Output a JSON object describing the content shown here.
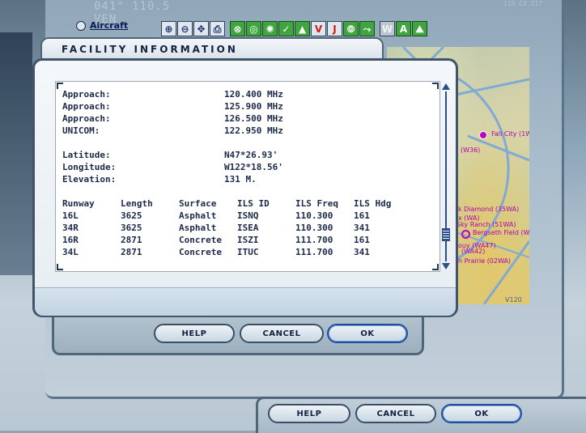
{
  "header": {
    "frequency_display": "041° 110.5 VEN",
    "right_display": "115 CX 117",
    "aircraft_label": "Aircraft"
  },
  "toolbar": {
    "buttons": [
      {
        "name": "zoom-in-icon",
        "glyph": "⊕",
        "style": "blue"
      },
      {
        "name": "zoom-out-icon",
        "glyph": "⊖",
        "style": "blue"
      },
      {
        "name": "center-icon",
        "glyph": "✥",
        "style": "blue"
      },
      {
        "name": "print-icon",
        "glyph": "⎙",
        "style": "blue"
      },
      {
        "name": "airport-icon",
        "glyph": "⊗",
        "style": "green"
      },
      {
        "name": "vor-icon",
        "glyph": "◎",
        "style": "green"
      },
      {
        "name": "ndb-icon",
        "glyph": "✺",
        "style": "green"
      },
      {
        "name": "ils-icon",
        "glyph": "✓",
        "style": "green"
      },
      {
        "name": "intersection-icon",
        "glyph": "▲",
        "style": "green"
      },
      {
        "name": "victor-airway-icon",
        "glyph": "V",
        "style": "red"
      },
      {
        "name": "jet-airway-icon",
        "glyph": "J",
        "style": "red"
      },
      {
        "name": "route-icon",
        "glyph": "⦾",
        "style": "green"
      },
      {
        "name": "flight-path-icon",
        "glyph": "⤳",
        "style": "green"
      },
      {
        "name": "wind-icon",
        "glyph": "W",
        "style": "grey"
      },
      {
        "name": "text-label-icon",
        "glyph": "A",
        "style": "green"
      },
      {
        "name": "terrain-icon",
        "glyph": "⛰",
        "style": "green"
      }
    ]
  },
  "map": {
    "labels": [
      "Fall City (1W",
      "ral (W36)",
      "k Diamond (35WA)",
      "x (WA)",
      "Sky Ranch (51WA)",
      "Bergseth Field (WA",
      "ouy (WA47)",
      "(WA42)",
      "h Prairie (02WA)",
      "V120"
    ]
  },
  "dialog": {
    "title": "FACILITY INFORMATION",
    "frequencies": [
      {
        "label": "Approach:",
        "value": "120.400 MHz"
      },
      {
        "label": "Approach:",
        "value": "125.900 MHz"
      },
      {
        "label": "Approach:",
        "value": "126.500 MHz"
      },
      {
        "label": "UNICOM:",
        "value": "122.950 MHz"
      }
    ],
    "location": [
      {
        "label": "Latitude:",
        "value": "N47*26.93'"
      },
      {
        "label": "Longitude:",
        "value": "W122*18.56'"
      },
      {
        "label": "Elevation:",
        "value": "131 M."
      }
    ],
    "runway_headers": [
      "Runway",
      "Length",
      "Surface",
      "ILS ID",
      "ILS Freq",
      "ILS Hdg"
    ],
    "runways": [
      [
        "16L",
        "3625",
        "Asphalt",
        "ISNQ",
        "110.300",
        "161"
      ],
      [
        "34R",
        "3625",
        "Asphalt",
        "ISEA",
        "110.300",
        "341"
      ],
      [
        "16R",
        "2871",
        "Concrete",
        "ISZI",
        "111.700",
        "161"
      ],
      [
        "34L",
        "2871",
        "Concrete",
        "ITUC",
        "111.700",
        "341"
      ]
    ],
    "buttons": {
      "help": "HELP",
      "cancel": "CANCEL",
      "ok": "OK"
    }
  },
  "lower_dialog": {
    "buttons": {
      "help": "HELP",
      "cancel": "CANCEL",
      "ok": "OK"
    }
  }
}
